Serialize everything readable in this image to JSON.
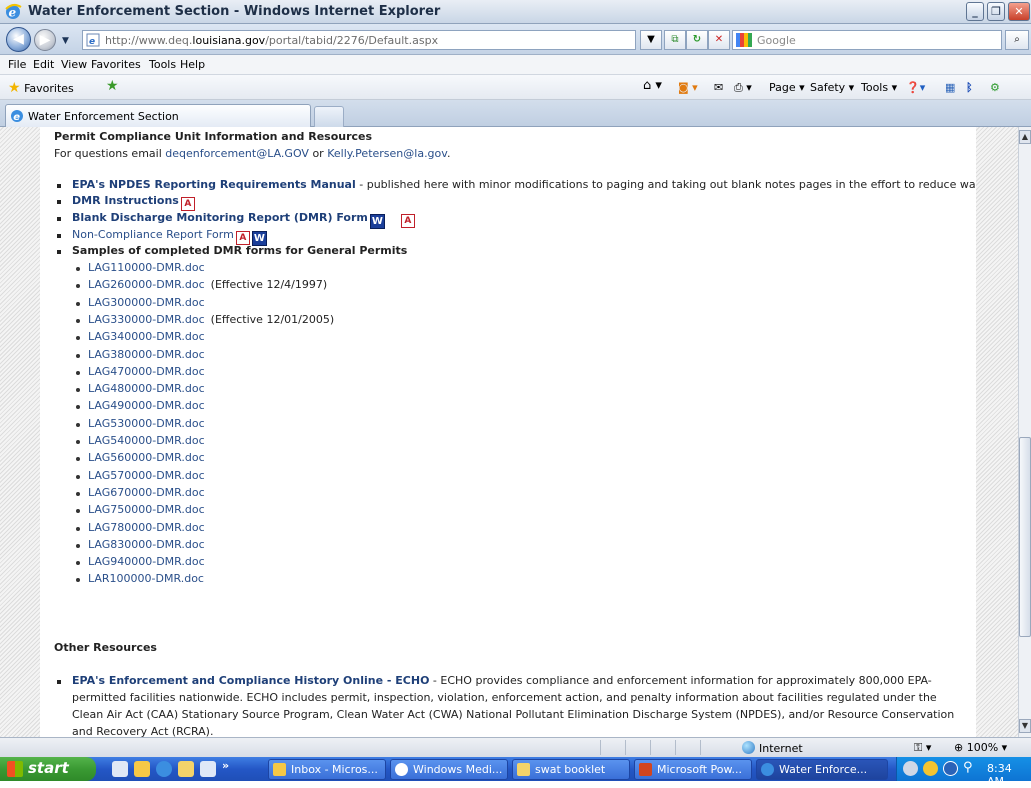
{
  "window": {
    "title": "Water Enforcement Section - Windows Internet Explorer"
  },
  "address": {
    "url_prefix": "http://www.deq.",
    "url_domain": "louisiana.gov",
    "url_suffix": "/portal/tabid/2276/Default.aspx"
  },
  "search": {
    "placeholder": "Google"
  },
  "menu": [
    "File",
    "Edit",
    "View",
    "Favorites",
    "Tools",
    "Help"
  ],
  "favorites": {
    "label": "Favorites"
  },
  "commandbar": {
    "page": "Page ▾",
    "safety": "Safety ▾",
    "tools": "Tools ▾"
  },
  "tab": {
    "label": "Water Enforcement Section"
  },
  "content": {
    "section_title": "Permit Compliance Unit Information and Resources",
    "contact_prefix": "For questions email ",
    "email1": "deqenforcement@LA.GOV",
    "contact_or": " or ",
    "email2": "Kelly.Petersen@la.gov",
    "contact_suffix": ".",
    "items": [
      {
        "link": "EPA's NPDES Reporting Requirements Manual",
        "desc": " - published here with minor modifications to paging and taking out blank notes pages in the effort to reduce wasted paper."
      },
      {
        "link": "DMR Instructions"
      },
      {
        "link": "Blank Discharge Monitoring Report (DMR) Form"
      },
      {
        "link": "Non-Compliance Report Form"
      },
      {
        "label": "Samples of completed DMR forms for General Permits"
      }
    ],
    "samples": [
      {
        "name": "LAG110000-DMR.doc",
        "note": ""
      },
      {
        "name": "LAG260000-DMR.doc",
        "note": "(Effective 12/4/1997)"
      },
      {
        "name": "LAG300000-DMR.doc",
        "note": ""
      },
      {
        "name": "LAG330000-DMR.doc",
        "note": "(Effective 12/01/2005)"
      },
      {
        "name": "LAG340000-DMR.doc",
        "note": ""
      },
      {
        "name": "LAG380000-DMR.doc",
        "note": ""
      },
      {
        "name": "LAG470000-DMR.doc",
        "note": ""
      },
      {
        "name": "LAG480000-DMR.doc",
        "note": ""
      },
      {
        "name": "LAG490000-DMR.doc",
        "note": ""
      },
      {
        "name": "LAG530000-DMR.doc",
        "note": ""
      },
      {
        "name": "LAG540000-DMR.doc",
        "note": ""
      },
      {
        "name": "LAG560000-DMR.doc",
        "note": ""
      },
      {
        "name": "LAG570000-DMR.doc",
        "note": ""
      },
      {
        "name": "LAG670000-DMR.doc",
        "note": ""
      },
      {
        "name": "LAG750000-DMR.doc",
        "note": ""
      },
      {
        "name": "LAG780000-DMR.doc",
        "note": ""
      },
      {
        "name": "LAG830000-DMR.doc",
        "note": ""
      },
      {
        "name": "LAG940000-DMR.doc",
        "note": ""
      },
      {
        "name": "LAR100000-DMR.doc",
        "note": ""
      }
    ],
    "other_title": "Other Resources",
    "echo_link": "EPA's Enforcement and Compliance History Online - ECHO",
    "echo_desc": " - ECHO provides compliance and enforcement information for approximately 800,000 EPA-permitted facilities nationwide. ECHO includes permit, inspection, violation, enforcement action, and penalty information about facilities regulated under the Clean Air Act (CAA) Stationary Source Program, Clean Water Act (CWA) National Pollutant Elimination Discharge System (NPDES), and/or Resource Conservation and Recovery Act (RCRA)."
  },
  "status": {
    "zone": "Internet",
    "zoom": "100%"
  },
  "taskbar": {
    "start": "start",
    "buttons": [
      "Inbox - Micros...",
      "Windows Medi...",
      "swat booklet",
      "Microsoft Pow...",
      "Water Enforce..."
    ],
    "clock": "8:34 AM"
  }
}
